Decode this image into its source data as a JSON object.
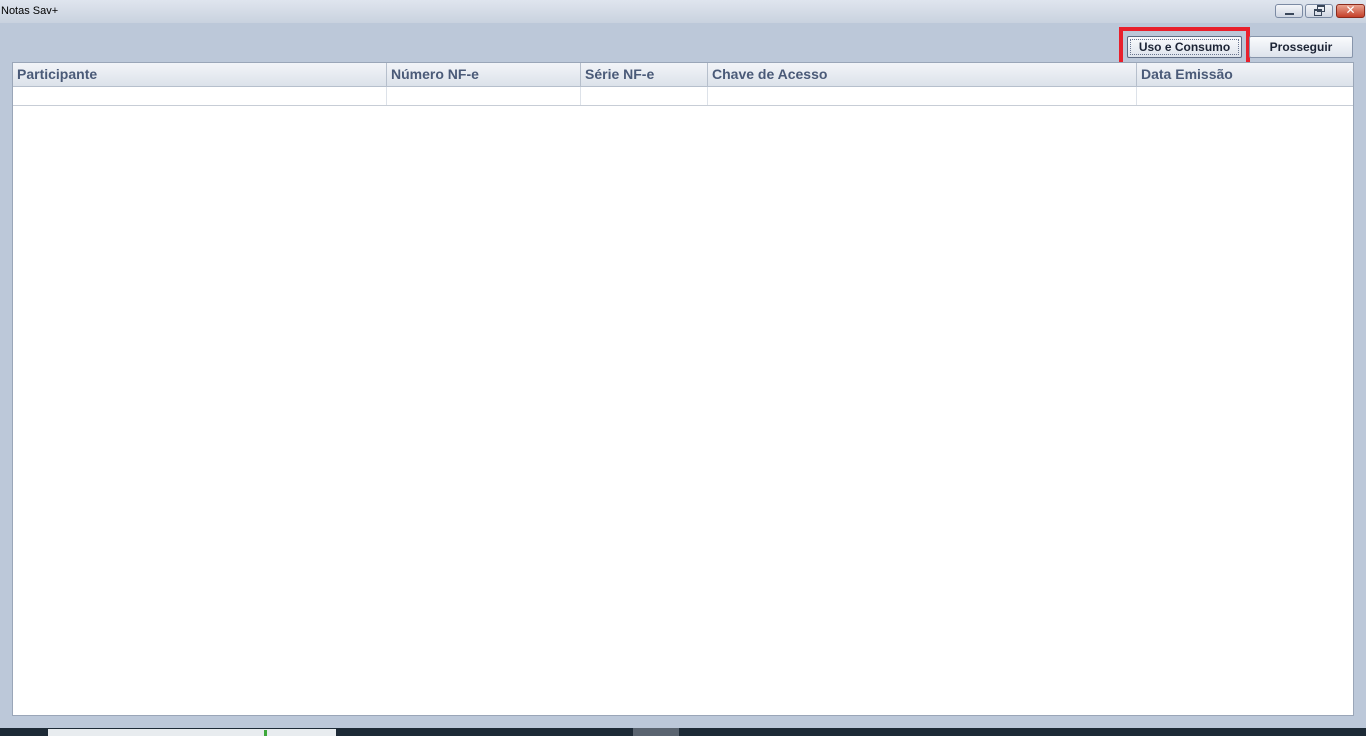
{
  "window": {
    "title": "Notas Sav+"
  },
  "window_controls": {
    "minimize_icon": "minimize-icon",
    "restore_icon": "restore-icon",
    "close_icon": "close-icon",
    "close_glyph": "✕"
  },
  "toolbar": {
    "uso_consumo_label": "Uso e Consumo",
    "prosseguir_label": "Prosseguir",
    "highlight_color": "#e8202c"
  },
  "table": {
    "columns": [
      "Participante",
      "Número NF-e",
      "Série NF-e",
      "Chave de Acesso",
      "Data Emissão"
    ],
    "rows": [
      [
        "",
        "",
        "",
        "",
        ""
      ]
    ]
  },
  "colors": {
    "background": "#bcc8d9",
    "header_text": "#4a5a78",
    "close_button": "#c4402a"
  }
}
